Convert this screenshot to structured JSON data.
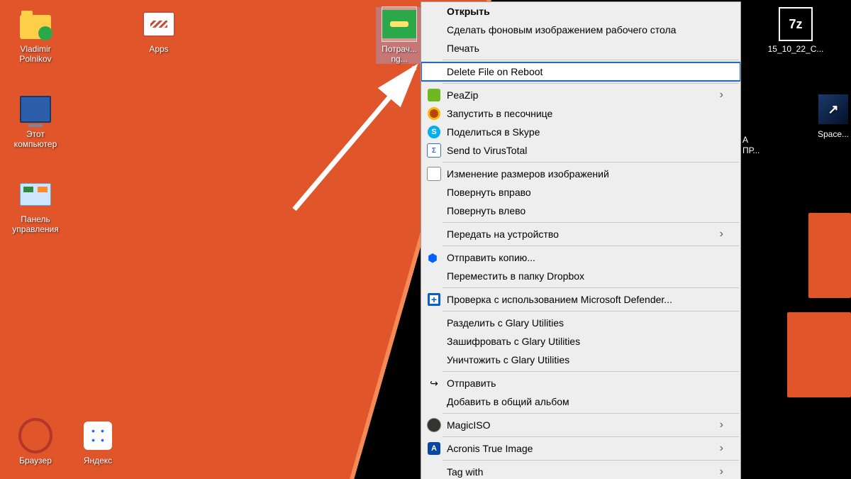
{
  "desktop_icons": {
    "user_folder": "Vladimir Polnikov",
    "apps": "Apps",
    "this_pc": "Этот компьютер",
    "control_panel": "Панель управления",
    "browser": "Браузер",
    "yandex": "Яндекс",
    "sevenz_archive": "15_10_22_C...",
    "space_app": "Space...",
    "selected_file": "Потрач... ng..."
  },
  "right_overlay_lines": {
    "a": "А",
    "b": "ПР..."
  },
  "context_menu": {
    "open": "Открыть",
    "set_wallpaper": "Сделать фоновым изображением рабочего стола",
    "print": "Печать",
    "delete_on_reboot": "Delete File on Reboot",
    "peazip": "PeaZip",
    "sandbox": "Запустить в песочнице",
    "skype_share": "Поделиться в Skype",
    "virustotal": "Send to VirusTotal",
    "resize": "Изменение размеров изображений",
    "rotate_right": "Повернуть вправо",
    "rotate_left": "Повернуть влево",
    "cast": "Передать на устройство",
    "dropbox_send": "Отправить копию...",
    "dropbox_move": "Переместить в папку Dropbox",
    "defender": "Проверка с использованием Microsoft Defender...",
    "glary_split": "Разделить с Glary Utilities",
    "glary_encrypt": "Зашифровать с Glary Utilities",
    "glary_destroy": "Уничтожить с Glary Utilities",
    "send": "Отправить",
    "album": "Добавить в общий альбом",
    "magiciso": "MagicISO",
    "acronis": "Acronis True Image",
    "tag_with": "Tag with"
  }
}
